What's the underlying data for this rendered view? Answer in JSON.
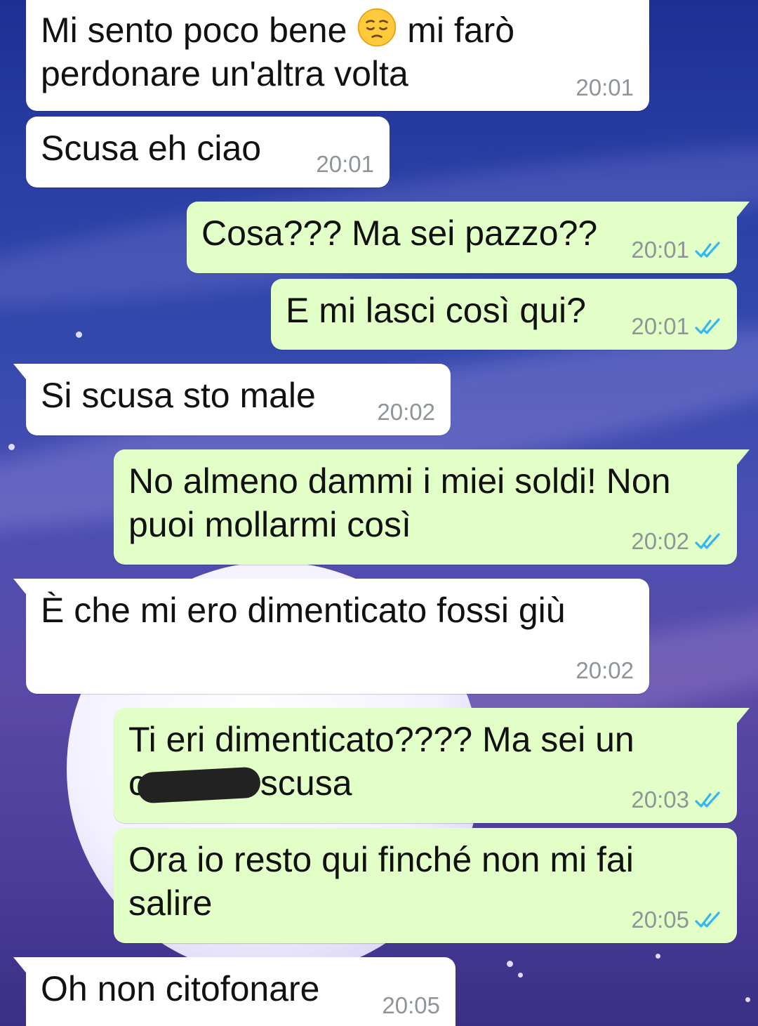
{
  "colors": {
    "incoming_bubble": "#ffffff",
    "outgoing_bubble": "#e2ffc7",
    "timestamp": "#8d9598",
    "read_ticks": "#34b7f1"
  },
  "messages": [
    {
      "direction": "incoming",
      "text_a": "Mi sento poco bene ",
      "emoji": "pensive-face",
      "text_b": " mi farò\nperdonare un'altra volta",
      "time": "20:01"
    },
    {
      "direction": "incoming",
      "text": "Scusa eh ciao",
      "time": "20:01"
    },
    {
      "direction": "outgoing",
      "text": "Cosa??? Ma sei pazzo??",
      "time": "20:01",
      "status": "read"
    },
    {
      "direction": "outgoing",
      "text": "E mi lasci così qui?",
      "time": "20:01",
      "status": "read"
    },
    {
      "direction": "incoming",
      "text": "Si scusa sto male",
      "time": "20:02"
    },
    {
      "direction": "outgoing",
      "text": "No almeno dammi i miei soldi! Non\npuoi mollarmi così",
      "time": "20:02",
      "status": "read"
    },
    {
      "direction": "incoming",
      "text": "È che mi ero dimenticato fossi giù",
      "time": "20:02"
    },
    {
      "direction": "outgoing",
      "text_a": "Ti eri dimenticato???? Ma sei un\nc",
      "text_b": " scusa",
      "time": "20:03",
      "status": "read"
    },
    {
      "direction": "outgoing",
      "text": "Ora io resto qui finché non mi fai\nsalire",
      "time": "20:05",
      "status": "read"
    },
    {
      "direction": "incoming",
      "text": "Oh non citofonare",
      "time": "20:05"
    }
  ]
}
